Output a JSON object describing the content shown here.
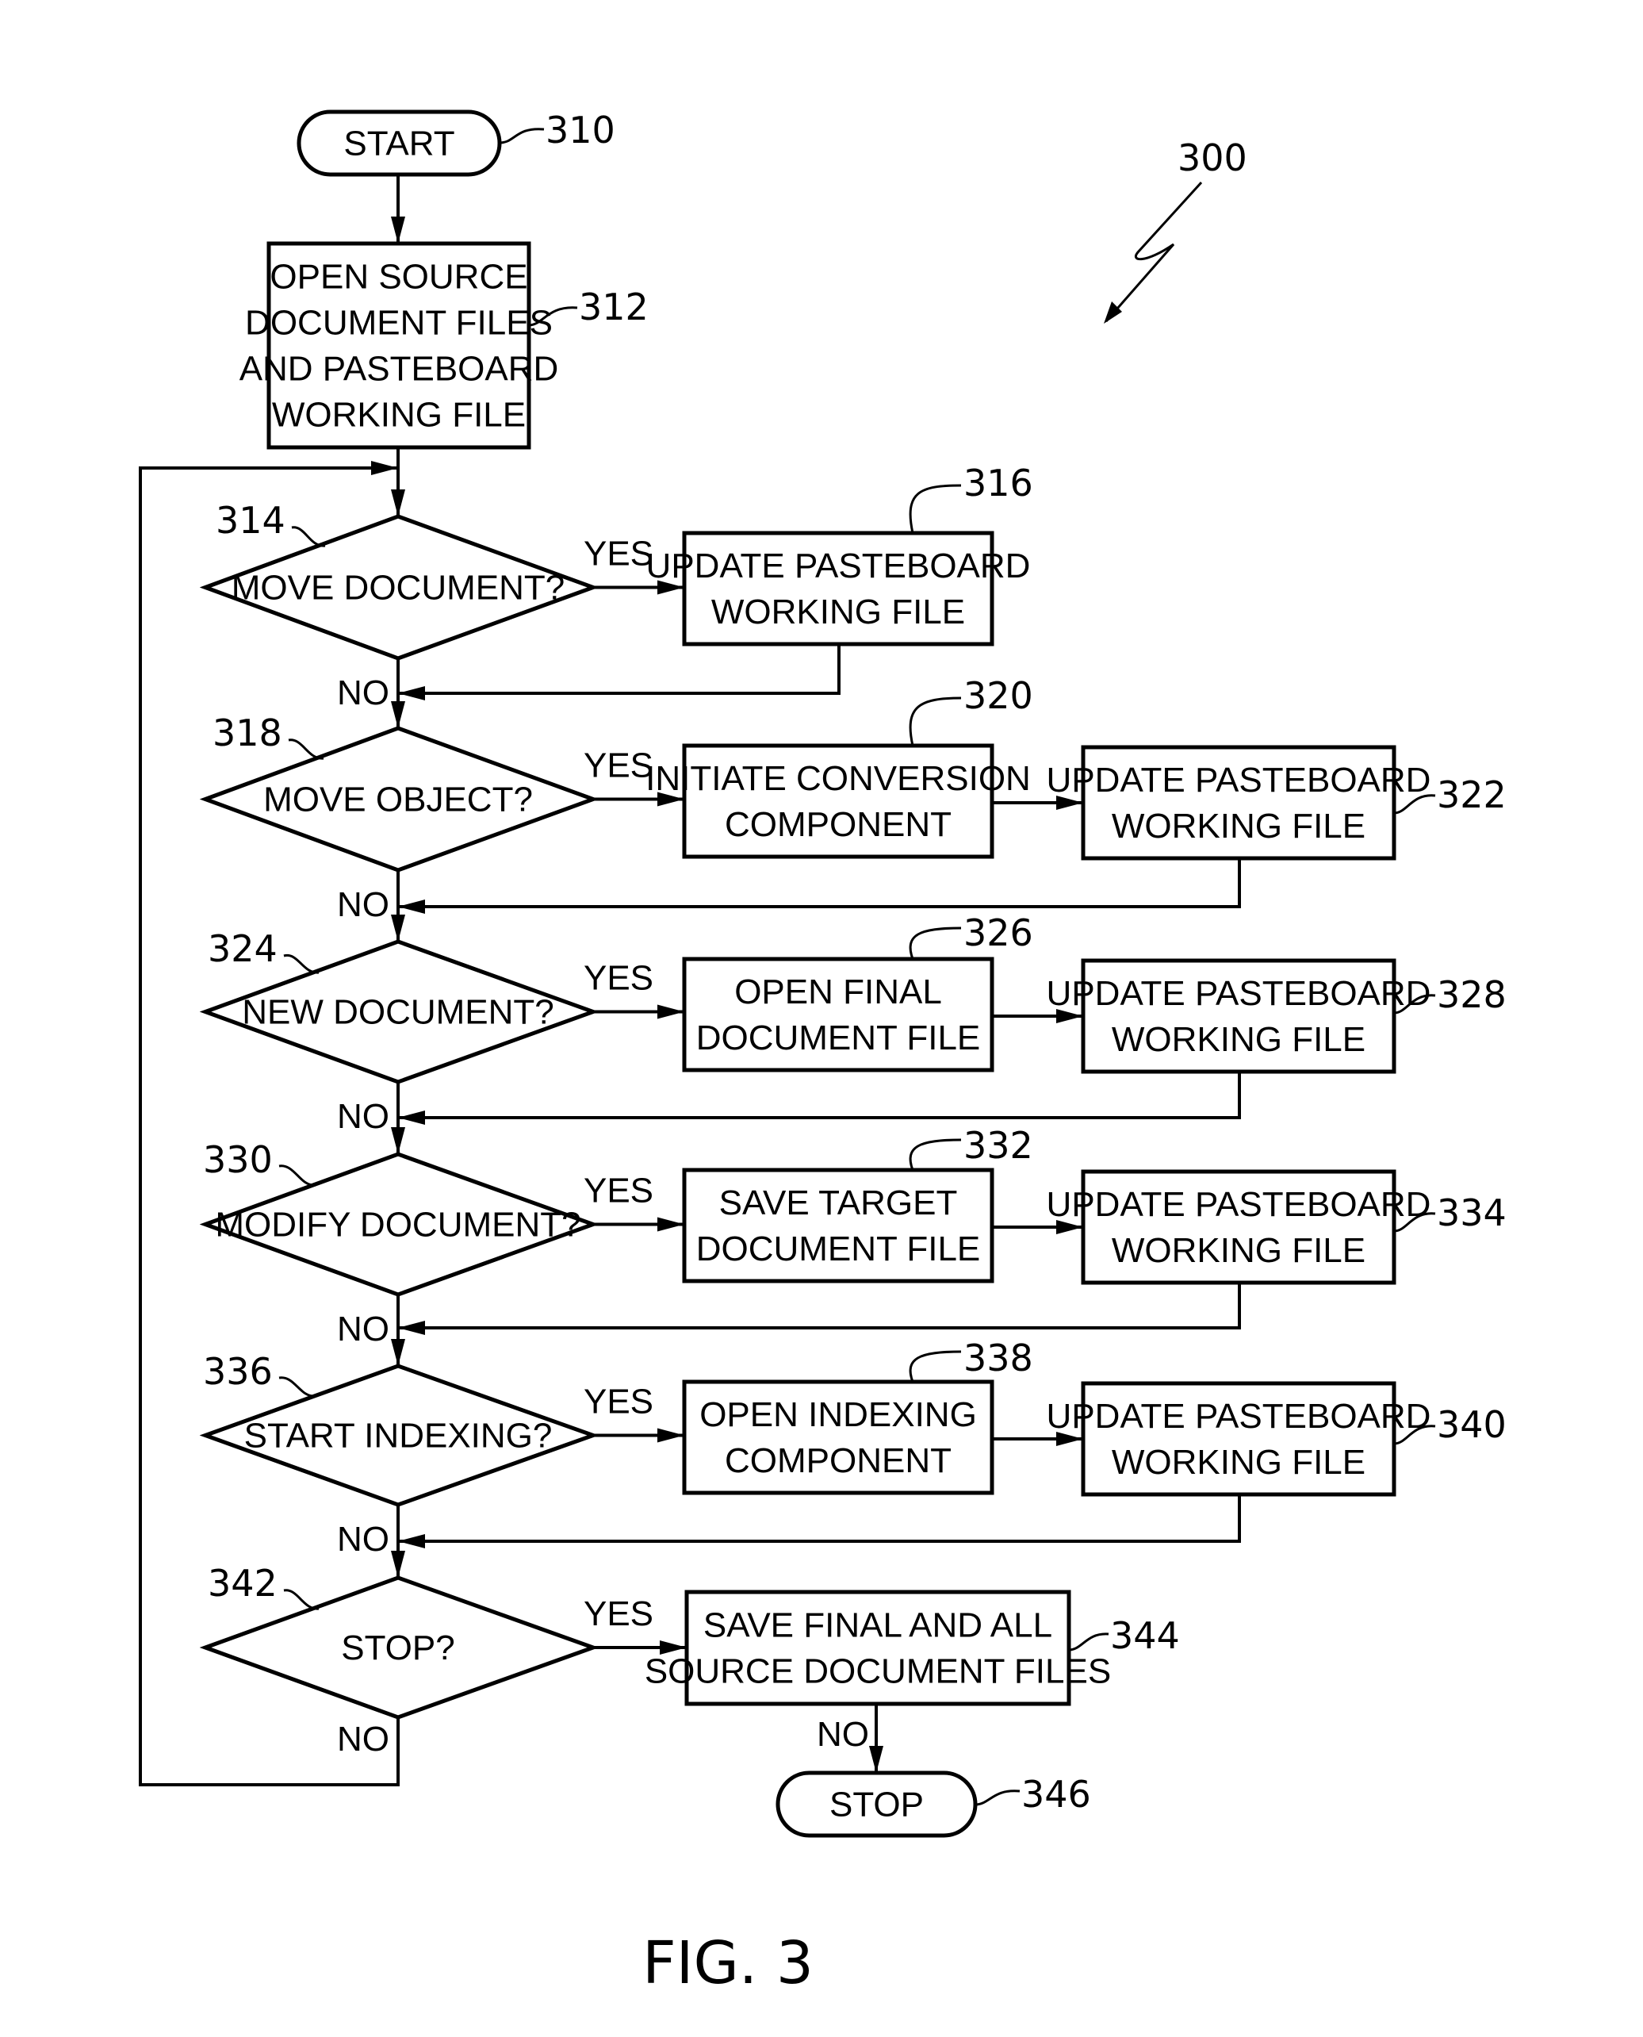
{
  "figure": {
    "caption": "FIG. 3",
    "reference": "300"
  },
  "nodes": {
    "start": {
      "ref": "310",
      "lines": [
        "START"
      ]
    },
    "n312": {
      "ref": "312",
      "lines": [
        "OPEN SOURCE",
        "DOCUMENT FILES",
        "AND PASTEBOARD",
        "WORKING FILE"
      ]
    },
    "d314": {
      "ref": "314",
      "lines": [
        "MOVE DOCUMENT?"
      ]
    },
    "n316": {
      "ref": "316",
      "lines": [
        "UPDATE PASTEBOARD",
        "WORKING FILE"
      ]
    },
    "d318": {
      "ref": "318",
      "lines": [
        "MOVE OBJECT?"
      ]
    },
    "n320": {
      "ref": "320",
      "lines": [
        "INITIATE CONVERSION",
        "COMPONENT"
      ]
    },
    "n322": {
      "ref": "322",
      "lines": [
        "UPDATE PASTEBOARD",
        "WORKING FILE"
      ]
    },
    "d324": {
      "ref": "324",
      "lines": [
        "NEW DOCUMENT?"
      ]
    },
    "n326": {
      "ref": "326",
      "lines": [
        "OPEN FINAL",
        "DOCUMENT FILE"
      ]
    },
    "n328": {
      "ref": "328",
      "lines": [
        "UPDATE PASTEBOARD",
        "WORKING FILE"
      ]
    },
    "d330": {
      "ref": "330",
      "lines": [
        "MODIFY DOCUMENT?"
      ]
    },
    "n332": {
      "ref": "332",
      "lines": [
        "SAVE TARGET",
        "DOCUMENT FILE"
      ]
    },
    "n334": {
      "ref": "334",
      "lines": [
        "UPDATE PASTEBOARD",
        "WORKING FILE"
      ]
    },
    "d336": {
      "ref": "336",
      "lines": [
        "START INDEXING?"
      ]
    },
    "n338": {
      "ref": "338",
      "lines": [
        "OPEN INDEXING",
        "COMPONENT"
      ]
    },
    "n340": {
      "ref": "340",
      "lines": [
        "UPDATE PASTEBOARD",
        "WORKING FILE"
      ]
    },
    "d342": {
      "ref": "342",
      "lines": [
        "STOP?"
      ]
    },
    "n344": {
      "ref": "344",
      "lines": [
        "SAVE FINAL AND ALL",
        "SOURCE DOCUMENT FILES"
      ]
    },
    "stop": {
      "ref": "346",
      "lines": [
        "STOP"
      ]
    }
  },
  "edge_labels": {
    "yes": "YES",
    "no": "NO"
  }
}
